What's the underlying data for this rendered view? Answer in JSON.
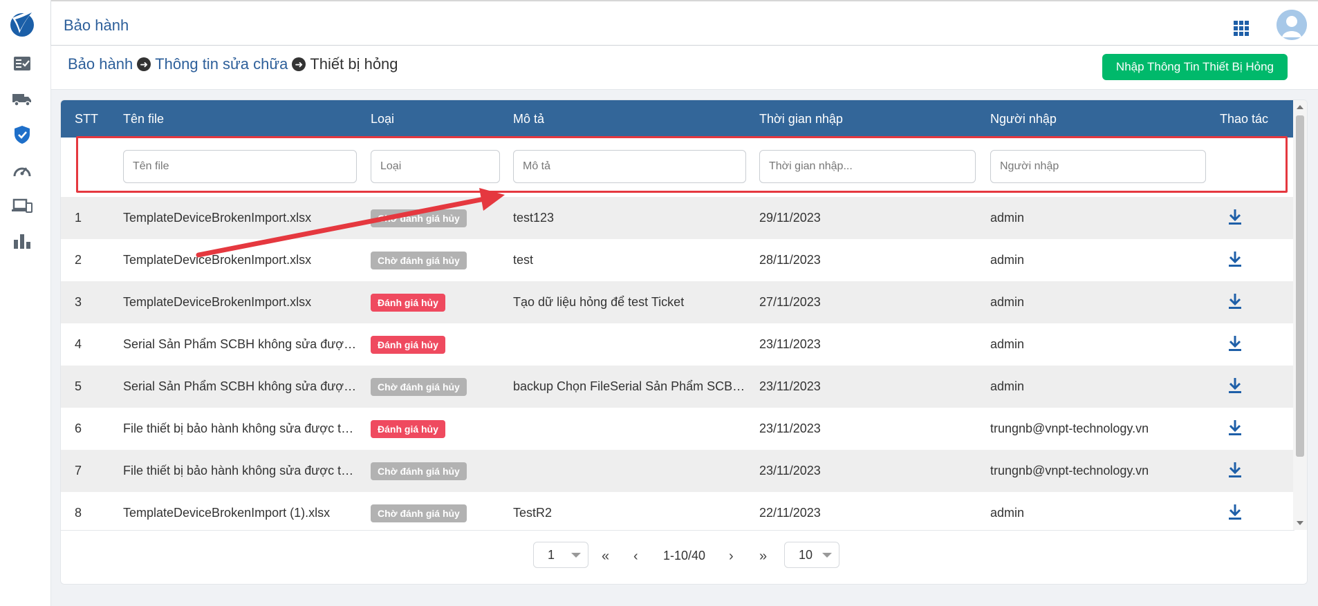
{
  "header": {
    "title": "Bảo hành"
  },
  "breadcrumb": {
    "items": [
      "Bảo hành",
      "Thông tin sửa chữa",
      "Thiết bị hỏng"
    ]
  },
  "actions": {
    "import_label": "Nhập Thông Tin Thiết Bị Hỏng"
  },
  "sidebar": {
    "items": [
      {
        "icon": "checklist-icon"
      },
      {
        "icon": "truck-icon"
      },
      {
        "icon": "shield-check-icon"
      },
      {
        "icon": "speedometer-icon"
      },
      {
        "icon": "devices-icon"
      },
      {
        "icon": "bar-chart-icon"
      }
    ]
  },
  "table": {
    "columns": [
      "STT",
      "Tên file",
      "Loại",
      "Mô tả",
      "Thời gian nhập",
      "Người nhập",
      "Thao tác"
    ],
    "filters": {
      "file_name": "Tên file",
      "type": "Loại",
      "description": "Mô tả",
      "time": "Thời gian nhập...",
      "user": "Người nhập"
    },
    "rows": [
      {
        "stt": "1",
        "file": "TemplateDeviceBrokenImport.xlsx",
        "type": "Chờ đánh giá hủy",
        "status": "gray",
        "desc": "test123",
        "time": "29/11/2023",
        "user": "admin"
      },
      {
        "stt": "2",
        "file": "TemplateDeviceBrokenImport.xlsx",
        "type": "Chờ đánh giá hủy",
        "status": "gray",
        "desc": "test",
        "time": "28/11/2023",
        "user": "admin"
      },
      {
        "stt": "3",
        "file": "TemplateDeviceBrokenImport.xlsx",
        "type": "Đánh giá hủy",
        "status": "red",
        "desc": "Tạo dữ liệu hỏng để test Ticket",
        "time": "27/11/2023",
        "user": "admin"
      },
      {
        "stt": "4",
        "file": "Serial Sản Phẩm SCBH không sửa được t...",
        "type": "Đánh giá hủy",
        "status": "red",
        "desc": "",
        "time": "23/11/2023",
        "user": "admin"
      },
      {
        "stt": "5",
        "file": "Serial Sản Phẩm SCBH không sửa được t...",
        "type": "Chờ đánh giá hủy",
        "status": "gray",
        "desc": "backup Chọn FileSerial Sản Phẩm SCBH k...",
        "time": "23/11/2023",
        "user": "admin"
      },
      {
        "stt": "6",
        "file": "File thiết bị bảo hành không sửa được thá...",
        "type": "Đánh giá hủy",
        "status": "red",
        "desc": "",
        "time": "23/11/2023",
        "user": "trungnb@vnpt-technology.vn"
      },
      {
        "stt": "7",
        "file": "File thiết bị bảo hành không sửa được thá...",
        "type": "Chờ đánh giá hủy",
        "status": "gray",
        "desc": "",
        "time": "23/11/2023",
        "user": "trungnb@vnpt-technology.vn"
      },
      {
        "stt": "8",
        "file": "TemplateDeviceBrokenImport (1).xlsx",
        "type": "Chờ đánh giá hủy",
        "status": "gray",
        "desc": "TestR2",
        "time": "22/11/2023",
        "user": "admin"
      }
    ]
  },
  "pagination": {
    "page": "1",
    "range": "1-10/40",
    "page_size": "10",
    "first": "«",
    "prev": "‹",
    "next": "›",
    "last": "»"
  },
  "colors": {
    "header_bg": "#336699",
    "import_btn": "#00b96b",
    "badge_red": "#ef4a5f",
    "badge_gray": "#b2b2b2",
    "annotation": "#e5383f"
  }
}
